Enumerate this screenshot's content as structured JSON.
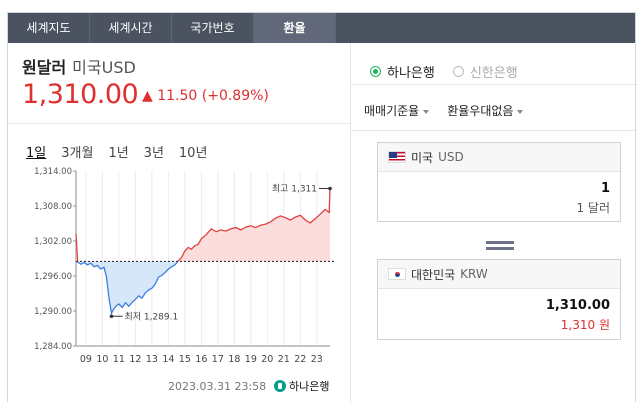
{
  "tabs": [
    {
      "label": "세계지도"
    },
    {
      "label": "세계시간"
    },
    {
      "label": "국가번호"
    },
    {
      "label": "환율"
    }
  ],
  "rate": {
    "title": "원달러",
    "currency_label": "미국USD",
    "price": "1,310.00",
    "change": "▲ 11.50 (+0.89%)"
  },
  "periods": [
    {
      "label": "1일"
    },
    {
      "label": "3개월"
    },
    {
      "label": "1년"
    },
    {
      "label": "3년"
    },
    {
      "label": "10년"
    }
  ],
  "chart_data": {
    "type": "line",
    "ylim": [
      1284,
      1314
    ],
    "y_ticks": [
      "1,314.00",
      "1,308.00",
      "1,302.00",
      "1,296.00",
      "1,290.00",
      "1,284.00"
    ],
    "x_ticks": [
      "09",
      "10",
      "11",
      "12",
      "13",
      "14",
      "15",
      "16",
      "17",
      "18",
      "19",
      "20",
      "21",
      "22",
      "23"
    ],
    "baseline": 1298.5,
    "series": [
      {
        "values": [
          [
            8.4,
            1303.2
          ],
          [
            8.5,
            1298.4
          ],
          [
            8.7,
            1298.0
          ],
          [
            8.9,
            1298.3
          ],
          [
            9.1,
            1297.9
          ],
          [
            9.3,
            1298.2
          ],
          [
            9.5,
            1297.6
          ],
          [
            9.7,
            1297.8
          ],
          [
            9.9,
            1297.2
          ],
          [
            10.1,
            1297.5
          ],
          [
            10.25,
            1295.8
          ],
          [
            10.4,
            1292.2
          ],
          [
            10.55,
            1289.6
          ],
          [
            10.7,
            1290.4
          ],
          [
            10.85,
            1290.9
          ],
          [
            11.0,
            1291.2
          ],
          [
            11.2,
            1290.6
          ],
          [
            11.4,
            1291.4
          ],
          [
            11.6,
            1290.8
          ],
          [
            11.8,
            1291.5
          ],
          [
            12.0,
            1292.0
          ],
          [
            12.2,
            1292.6
          ],
          [
            12.4,
            1292.2
          ],
          [
            12.6,
            1293.1
          ],
          [
            12.8,
            1293.6
          ],
          [
            13.0,
            1293.9
          ],
          [
            13.2,
            1294.6
          ],
          [
            13.4,
            1295.8
          ],
          [
            13.6,
            1296.1
          ],
          [
            13.8,
            1296.6
          ],
          [
            14.0,
            1297.2
          ],
          [
            14.2,
            1297.6
          ],
          [
            14.4,
            1297.9
          ],
          [
            14.6,
            1298.6
          ],
          [
            14.8,
            1299.2
          ],
          [
            15.0,
            1300.3
          ],
          [
            15.2,
            1300.9
          ],
          [
            15.4,
            1300.6
          ],
          [
            15.6,
            1301.2
          ],
          [
            15.8,
            1301.4
          ],
          [
            16.0,
            1302.4
          ],
          [
            16.3,
            1303.1
          ],
          [
            16.6,
            1304.1
          ],
          [
            16.9,
            1303.6
          ],
          [
            17.2,
            1303.9
          ],
          [
            17.5,
            1303.7
          ],
          [
            17.8,
            1304.1
          ],
          [
            18.1,
            1304.3
          ],
          [
            18.4,
            1303.9
          ],
          [
            18.7,
            1304.4
          ],
          [
            19.0,
            1304.6
          ],
          [
            19.3,
            1304.3
          ],
          [
            19.6,
            1304.7
          ],
          [
            19.9,
            1304.9
          ],
          [
            20.2,
            1305.3
          ],
          [
            20.5,
            1305.9
          ],
          [
            20.8,
            1306.3
          ],
          [
            21.1,
            1306.0
          ],
          [
            21.4,
            1305.6
          ],
          [
            21.7,
            1306.1
          ],
          [
            22.0,
            1306.4
          ],
          [
            22.3,
            1305.6
          ],
          [
            22.6,
            1305.1
          ],
          [
            22.9,
            1305.8
          ],
          [
            23.2,
            1306.6
          ],
          [
            23.5,
            1307.4
          ],
          [
            23.75,
            1306.9
          ],
          [
            23.8,
            1311.0
          ]
        ]
      }
    ],
    "annotations": [
      {
        "label": "최고 1,311",
        "x": 23.8,
        "y": 1311.0
      },
      {
        "label": "최저 1,289.1",
        "x": 10.55,
        "y": 1289.1
      }
    ],
    "colors": {
      "up": "#e24040",
      "down": "#3b7fe0",
      "up_fill": "#fbd7d7",
      "down_fill": "#cfe3f9"
    }
  },
  "timestamp": "2023.03.31  23:58",
  "logo_text": "하나은행",
  "banks": [
    {
      "label": "하나은행",
      "selected": true
    },
    {
      "label": "신한은행",
      "selected": false
    }
  ],
  "selects": [
    {
      "label": "매매기준율"
    },
    {
      "label": "환율우대없음"
    }
  ],
  "from": {
    "country": "미국",
    "code": "USD",
    "amount": "1",
    "unit_text": "1 달러"
  },
  "to": {
    "country": "대한민국",
    "code": "KRW",
    "amount": "1,310.00",
    "unit_text": "1,310 원"
  }
}
